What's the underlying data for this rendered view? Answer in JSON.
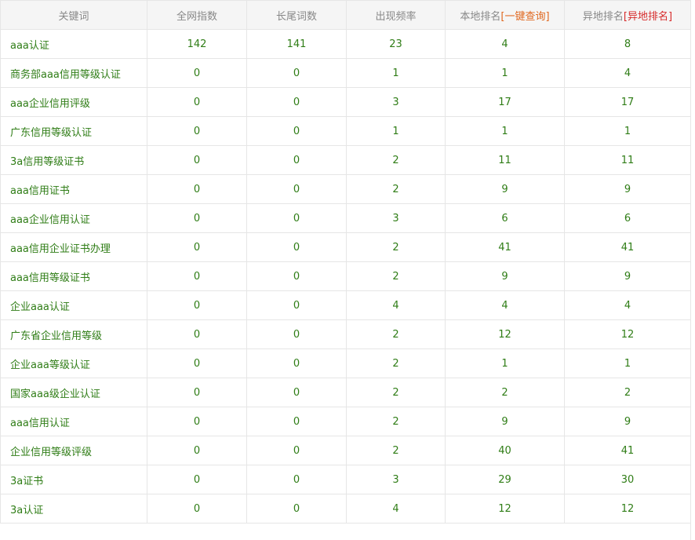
{
  "headers": {
    "keyword": "关键词",
    "global_index": "全网指数",
    "longtail_count": "长尾词数",
    "frequency": "出现频率",
    "local_rank": "本地排名",
    "local_rank_link": "[一键查询]",
    "remote_rank": "异地排名",
    "remote_rank_link": "[异地排名]"
  },
  "colors": {
    "text_green": "#2f7d16",
    "header_gray": "#888888",
    "link_orange": "#e0671e",
    "link_red": "#d62b2b"
  },
  "rows": [
    {
      "keyword": "aaa认证",
      "global_index": "142",
      "longtail_count": "141",
      "frequency": "23",
      "local_rank": "4",
      "remote_rank": "8"
    },
    {
      "keyword": "商务部aaa信用等级认证",
      "global_index": "0",
      "longtail_count": "0",
      "frequency": "1",
      "local_rank": "1",
      "remote_rank": "4"
    },
    {
      "keyword": "aaa企业信用评级",
      "global_index": "0",
      "longtail_count": "0",
      "frequency": "3",
      "local_rank": "17",
      "remote_rank": "17"
    },
    {
      "keyword": "广东信用等级认证",
      "global_index": "0",
      "longtail_count": "0",
      "frequency": "1",
      "local_rank": "1",
      "remote_rank": "1"
    },
    {
      "keyword": "3a信用等级证书",
      "global_index": "0",
      "longtail_count": "0",
      "frequency": "2",
      "local_rank": "11",
      "remote_rank": "11"
    },
    {
      "keyword": "aaa信用证书",
      "global_index": "0",
      "longtail_count": "0",
      "frequency": "2",
      "local_rank": "9",
      "remote_rank": "9"
    },
    {
      "keyword": "aaa企业信用认证",
      "global_index": "0",
      "longtail_count": "0",
      "frequency": "3",
      "local_rank": "6",
      "remote_rank": "6"
    },
    {
      "keyword": "aaa信用企业证书办理",
      "global_index": "0",
      "longtail_count": "0",
      "frequency": "2",
      "local_rank": "41",
      "remote_rank": "41"
    },
    {
      "keyword": "aaa信用等级证书",
      "global_index": "0",
      "longtail_count": "0",
      "frequency": "2",
      "local_rank": "9",
      "remote_rank": "9"
    },
    {
      "keyword": "企业aaa认证",
      "global_index": "0",
      "longtail_count": "0",
      "frequency": "4",
      "local_rank": "4",
      "remote_rank": "4"
    },
    {
      "keyword": "广东省企业信用等级",
      "global_index": "0",
      "longtail_count": "0",
      "frequency": "2",
      "local_rank": "12",
      "remote_rank": "12"
    },
    {
      "keyword": "企业aaa等级认证",
      "global_index": "0",
      "longtail_count": "0",
      "frequency": "2",
      "local_rank": "1",
      "remote_rank": "1"
    },
    {
      "keyword": "国家aaa级企业认证",
      "global_index": "0",
      "longtail_count": "0",
      "frequency": "2",
      "local_rank": "2",
      "remote_rank": "2"
    },
    {
      "keyword": "aaa信用认证",
      "global_index": "0",
      "longtail_count": "0",
      "frequency": "2",
      "local_rank": "9",
      "remote_rank": "9"
    },
    {
      "keyword": "企业信用等级评级",
      "global_index": "0",
      "longtail_count": "0",
      "frequency": "2",
      "local_rank": "40",
      "remote_rank": "41"
    },
    {
      "keyword": "3a证书",
      "global_index": "0",
      "longtail_count": "0",
      "frequency": "3",
      "local_rank": "29",
      "remote_rank": "30"
    },
    {
      "keyword": "3a认证",
      "global_index": "0",
      "longtail_count": "0",
      "frequency": "4",
      "local_rank": "12",
      "remote_rank": "12"
    }
  ]
}
